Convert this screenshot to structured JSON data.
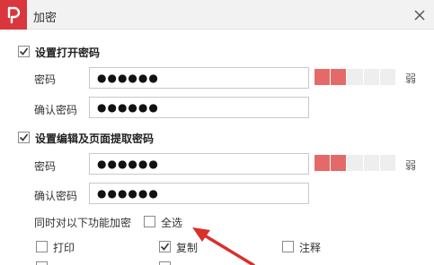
{
  "window": {
    "title": "加密",
    "accent": "#d9363e"
  },
  "open_password": {
    "section_label": "设置打开密码",
    "checked": true,
    "password_label": "密码",
    "password_value": "●●●●●●",
    "confirm_label": "确认密码",
    "confirm_value": "●●●●●●",
    "strength_text": "弱",
    "strength_level": 0.4
  },
  "edit_password": {
    "section_label": "设置编辑及页面提取密码",
    "checked": true,
    "password_label": "密码",
    "password_value": "●●●●●●",
    "confirm_label": "确认密码",
    "confirm_value": "●●●●●●",
    "strength_text": "弱",
    "strength_level": 0.4
  },
  "permissions": {
    "intro_label": "同时对以下功能加密",
    "select_all_label": "全选",
    "select_all_checked": false,
    "items": [
      {
        "label": "打印",
        "checked": false
      },
      {
        "label": "复制",
        "checked": true
      },
      {
        "label": "注释",
        "checked": false
      }
    ]
  },
  "colors": {
    "strength_on": "#e46a6a",
    "strength_off": "#eeeeee",
    "annotation_arrow": "#d9302b"
  }
}
